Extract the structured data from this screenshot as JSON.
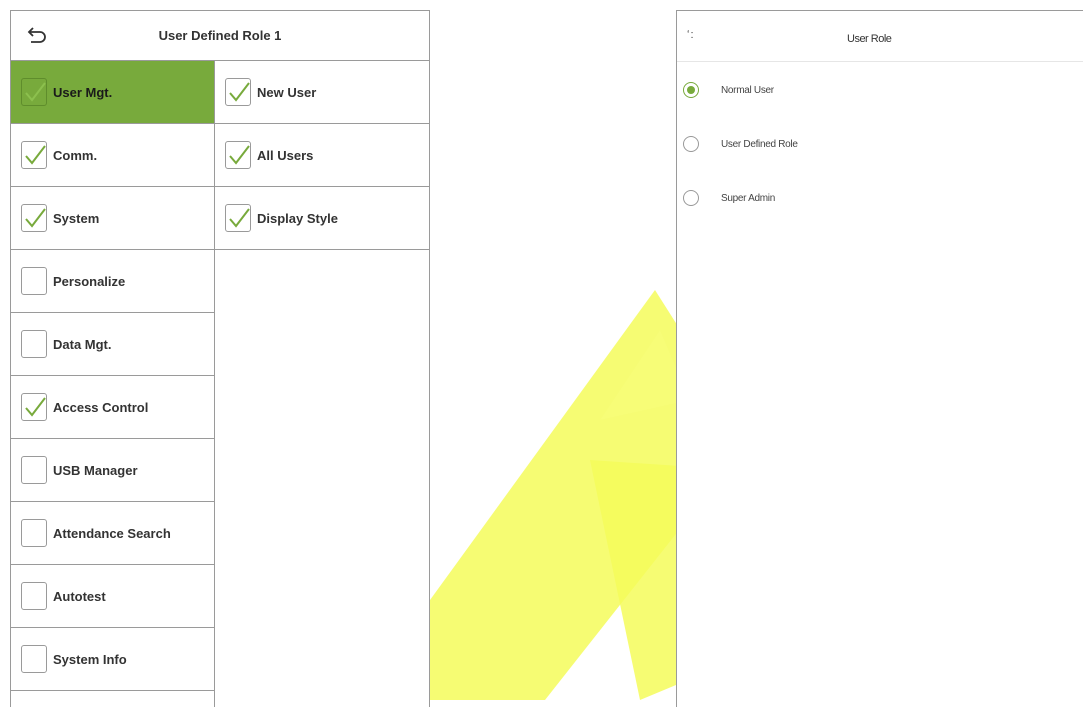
{
  "left": {
    "title": "User Defined Role 1",
    "categories": [
      {
        "label": "User Mgt.",
        "checked": true,
        "selected": true
      },
      {
        "label": "Comm.",
        "checked": true,
        "selected": false
      },
      {
        "label": "System",
        "checked": true,
        "selected": false
      },
      {
        "label": "Personalize",
        "checked": false,
        "selected": false
      },
      {
        "label": "Data Mgt.",
        "checked": false,
        "selected": false
      },
      {
        "label": "Access Control",
        "checked": true,
        "selected": false
      },
      {
        "label": "USB Manager",
        "checked": false,
        "selected": false
      },
      {
        "label": "Attendance Search",
        "checked": false,
        "selected": false
      },
      {
        "label": "Autotest",
        "checked": false,
        "selected": false
      },
      {
        "label": "System Info",
        "checked": false,
        "selected": false
      }
    ],
    "subitems": [
      {
        "label": "New User",
        "checked": true
      },
      {
        "label": "All Users",
        "checked": true
      },
      {
        "label": "Display Style",
        "checked": true
      }
    ]
  },
  "right": {
    "back_text": "ʻ:",
    "title": "User Role",
    "options": [
      {
        "label": "Normal User",
        "selected": true
      },
      {
        "label": "User Defined Role",
        "selected": false
      },
      {
        "label": "Super Admin",
        "selected": false
      }
    ]
  },
  "colors": {
    "accent": "#78aa3c",
    "border": "#9a9a9a",
    "watermark": "#f3fb3a"
  },
  "icons": {
    "back": "back-arrow-icon",
    "check": "checkmark-icon",
    "radio": "radio-button-icon"
  }
}
